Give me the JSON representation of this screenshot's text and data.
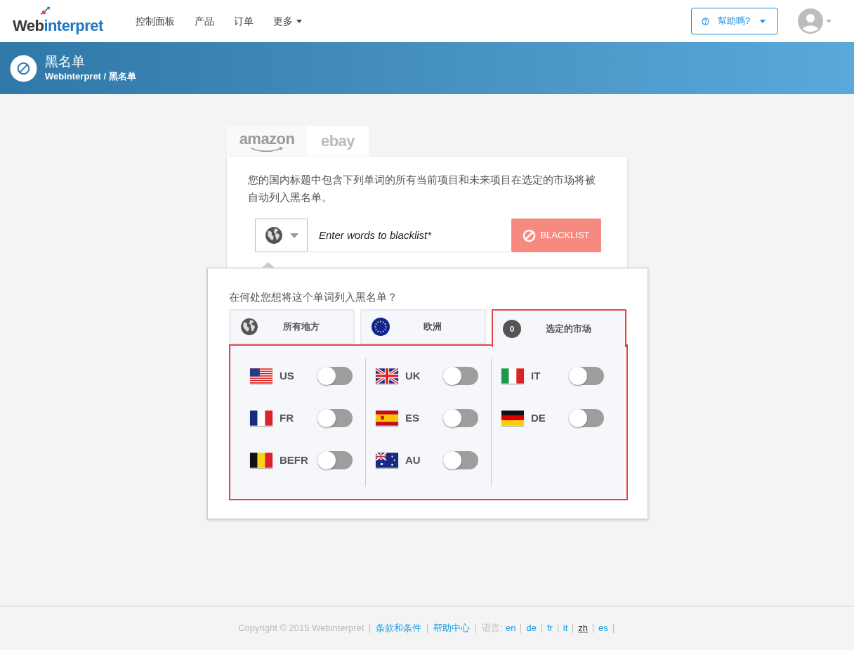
{
  "header": {
    "logo": [
      "Web",
      "interpret"
    ],
    "nav": [
      {
        "label": "控制面板",
        "dropdown": false
      },
      {
        "label": "产品",
        "dropdown": false
      },
      {
        "label": "订单",
        "dropdown": false
      },
      {
        "label": "更多",
        "dropdown": true
      }
    ],
    "help_button": "幫助嗎?"
  },
  "banner": {
    "title": "黑名单",
    "breadcrumb": "Webinterpret / 黑名单"
  },
  "market_tabs": [
    {
      "label": "amazon",
      "selected": true
    },
    {
      "label": "ebay",
      "selected": false
    }
  ],
  "description": "您的国内标题中包含下列单词的所有当前项目和未来项目在选定的市场将被自动列入黑名单。",
  "blacklist_form": {
    "placeholder": "Enter words to blacklist*",
    "button": "BLACKLIST"
  },
  "scope_popover": {
    "question": "在何处您想将这个单词列入黑名单？",
    "options": [
      {
        "kind": "globe",
        "label": "所有地方",
        "selected": false
      },
      {
        "kind": "eu",
        "label": "欧洲",
        "selected": false
      },
      {
        "kind": "count",
        "badge": "0",
        "label": "选定的市场",
        "selected": true
      }
    ],
    "market_columns": [
      [
        {
          "code": "US",
          "on": false
        },
        {
          "code": "FR",
          "on": false
        },
        {
          "code": "BEFR",
          "on": false
        }
      ],
      [
        {
          "code": "UK",
          "on": false
        },
        {
          "code": "ES",
          "on": false
        },
        {
          "code": "AU",
          "on": false
        }
      ],
      [
        {
          "code": "IT",
          "on": false
        },
        {
          "code": "DE",
          "on": false
        }
      ]
    ]
  },
  "footer": {
    "copyright": "Copyright © 2015 Webinterpret",
    "links": [
      "条款和条件",
      "帮助中心"
    ],
    "language_label": "语言:",
    "languages": [
      {
        "label": "en",
        "selected": false
      },
      {
        "label": "de",
        "selected": false
      },
      {
        "label": "fr",
        "selected": false
      },
      {
        "label": "it",
        "selected": false
      },
      {
        "label": "zh",
        "selected": true
      },
      {
        "label": "es",
        "selected": false
      }
    ]
  }
}
